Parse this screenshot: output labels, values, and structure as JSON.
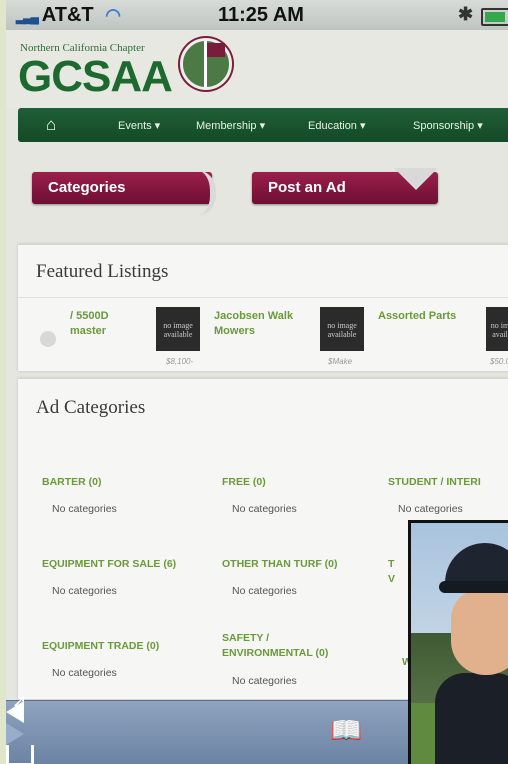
{
  "status": {
    "carrier": "AT&T",
    "time": "11:25 AM"
  },
  "brand": {
    "chapter": "Northern California Chapter",
    "logo": "GCSAA"
  },
  "nav": {
    "items": [
      "Events ▾",
      "Membership ▾",
      "Education ▾",
      "Sponsorship ▾"
    ]
  },
  "actions": {
    "categories": "Categories",
    "post_ad": "Post an Ad"
  },
  "featured": {
    "title": "Featured Listings",
    "items": [
      {
        "title": "/ 5500D master",
        "price": ""
      },
      {
        "title": "Jacobsen Walk Mowers",
        "thumb": "no image available",
        "price": "$8,100-"
      },
      {
        "title": "Assorted Parts",
        "thumb": "no image available",
        "price": "$Make"
      },
      {
        "title": "",
        "thumb": "no im avail",
        "price": "$50.0"
      }
    ]
  },
  "ad_categories": {
    "title": "Ad Categories",
    "items": [
      {
        "title": "BARTER (0)",
        "note": "No categories"
      },
      {
        "title": "FREE (0)",
        "note": "No categories"
      },
      {
        "title": "STUDENT / INTERI",
        "note": "No categories"
      },
      {
        "title": "EQUIPMENT FOR SALE (6)",
        "note": "No categories"
      },
      {
        "title": "OTHER THAN TURF (0)",
        "note": "No categories"
      },
      {
        "title": "T\nV",
        "note": ""
      },
      {
        "title": "EQUIPMENT TRADE (0)",
        "note": "No categories"
      },
      {
        "title": "SAFETY / ENVIRONMENTAL (0)",
        "note": "No categories"
      },
      {
        "title": "W",
        "note": ""
      }
    ]
  },
  "icons": {
    "home": "home-icon",
    "back": "back-arrow-icon",
    "forward": "forward-arrow-icon",
    "share": "share-icon",
    "bookmarks": "bookmarks-icon"
  },
  "colors": {
    "nav_green": "#1f5e36",
    "button_maroon": "#8a1740",
    "link_green": "#6a9a3a",
    "toolbar_blue": "#7d93b3"
  }
}
